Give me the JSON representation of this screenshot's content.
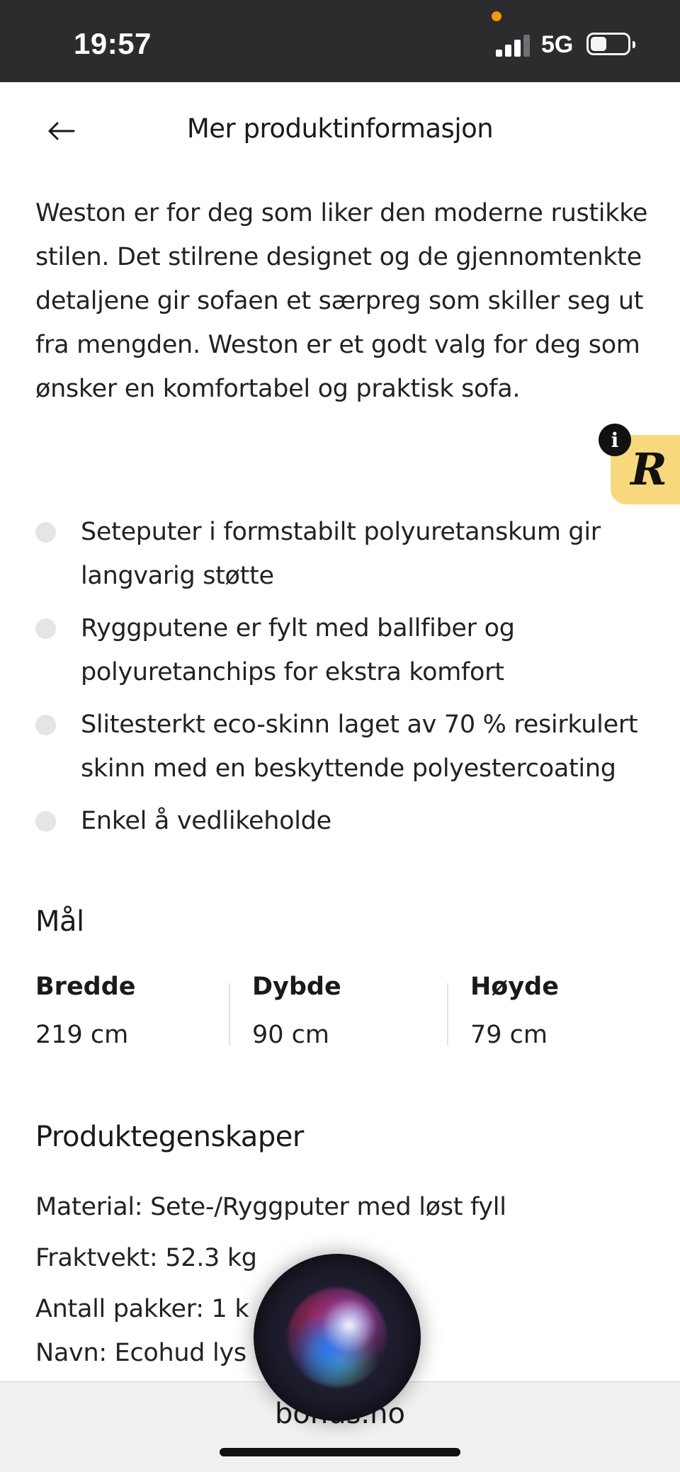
{
  "status_bar": {
    "time": "19:57",
    "network": "5G",
    "battery_level": 0.4,
    "signal_bars": 3
  },
  "header": {
    "title": "Mer produktinformasjon",
    "back_icon": "arrow-left-icon"
  },
  "description": "Weston er for deg som liker den moderne rustikke stilen. Det stilrene designet og de gjennomtenkte detaljene gir sofaen et særpreg som skiller seg ut fra mengden. Weston er et godt valg for deg som ønsker en komfortabel og praktisk sofa.",
  "badges": {
    "info_symbol": "i",
    "r_letter": "R",
    "r_color": "#f7d87c"
  },
  "features": [
    "Seteputer i formstabilt polyuretanskum gir langvarig støtte",
    "Ryggputene er fylt med ballfiber og polyuretanchips for ekstra komfort",
    "Slitesterkt eco-skinn laget av 70 % resirkulert skinn med en beskyttende polyestercoating",
    "Enkel å vedlikeholde"
  ],
  "dimensions": {
    "heading": "Mål",
    "items": [
      {
        "label": "Bredde",
        "value": "219 cm"
      },
      {
        "label": "Dybde",
        "value": "90 cm"
      },
      {
        "label": "Høyde",
        "value": "79 cm"
      }
    ]
  },
  "properties": {
    "heading": "Produktegenskaper",
    "lines": [
      "Material: Sete-/Ryggputer med løst fyll",
      "Fraktvekt: 52.3 kg",
      "Antall pakker: 1 k",
      "Navn: Ecohud lys"
    ]
  },
  "browser": {
    "url": "bohus.no"
  }
}
